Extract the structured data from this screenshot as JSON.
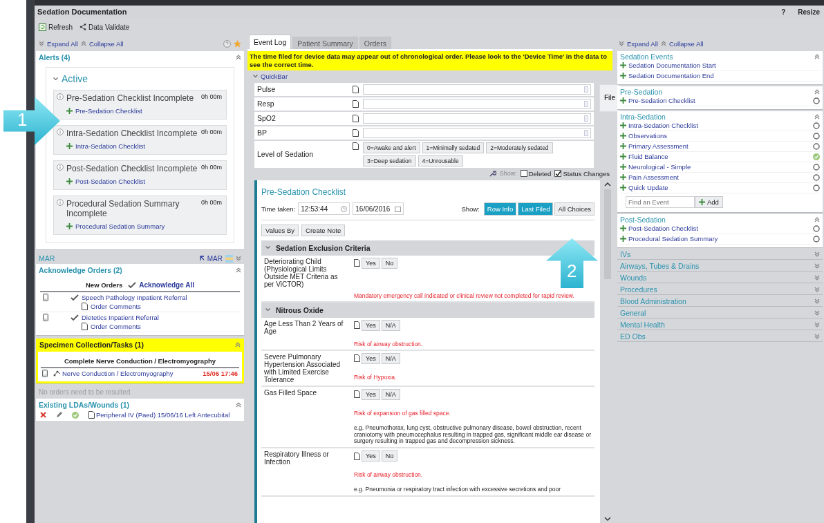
{
  "window": {
    "title": "Sedation Documentation",
    "help": "?",
    "resize": "Resize"
  },
  "toolbar": [
    "Refresh",
    "Data Validate"
  ],
  "callouts": [
    "1",
    "2"
  ],
  "left": {
    "expand_all": "Expand All",
    "collapse_all": "Collapse All",
    "alerts": {
      "title": "Alerts (4)",
      "group": "Active",
      "items": [
        {
          "title": "Pre-Sedation Checklist Incomplete",
          "time": "0h 00m",
          "action": "Pre-Sedation Checklist"
        },
        {
          "title": "Intra-Sedation Checklist Incomplete",
          "time": "0h 00m",
          "action": "Intra-Sedation Checklist"
        },
        {
          "title": "Post-Sedation Checklist Incomplete",
          "time": "0h 00m",
          "action": "Post-Sedation Checklist"
        },
        {
          "title": "Procedural Sedation Summary Incomplete",
          "time": "0h 00m",
          "action": "Procedural Sedation Summary"
        }
      ]
    },
    "mar": {
      "title": "MAR",
      "link": "MAR"
    },
    "acknowledge_orders": {
      "title": "Acknowledge Orders (2)",
      "heading": "New Orders",
      "action": "Acknowledge All",
      "orders": [
        {
          "name": "Speech Pathology Inpatient Referral",
          "comment": "Order Comments"
        },
        {
          "name": "Dietetics Inpatient Referral",
          "comment": "Order Comments"
        }
      ]
    },
    "specimen": {
      "title": "Specimen Collection/Tasks (1)",
      "heading": "Complete Nerve Conduction / Electromyography",
      "task": "Nerve Conduction / Electromyography",
      "time": "15/06 17:46"
    },
    "note": "No orders need to be resulted",
    "ldas": {
      "title": "Existing LDAs/Wounds (1)",
      "item": "Peripheral IV (Paed) 15/06/16 Left Antecubital"
    }
  },
  "center": {
    "tabs": [
      {
        "label": "Event Log",
        "selected": true
      },
      {
        "label": "Patient Summary",
        "selected": false
      },
      {
        "label": "Orders",
        "selected": false
      }
    ],
    "banner": "The time filed for device data may appear out of chronological order. Please look to the 'Device Time' in the data to see the correct time.",
    "quickbar": {
      "title": "QuickBar",
      "fields": [
        {
          "label": "Pulse"
        },
        {
          "label": "Resp"
        },
        {
          "label": "SpO2"
        },
        {
          "label": "BP"
        }
      ],
      "sedation_label": "Level of Sedation",
      "sedation_options": [
        "0=Awake and alert",
        "1=Minimally sedated",
        "2=Moderately sedated",
        "3=Deep sedation",
        "4=Unrousable"
      ],
      "file": "File"
    },
    "show_filters": {
      "label": "Show:",
      "options": [
        {
          "label": "Deleted",
          "checked": false
        },
        {
          "label": "Status Changes",
          "checked": true
        }
      ]
    },
    "form": {
      "title": "Pre-Sedation Checklist",
      "time_label": "Time taken:",
      "time": "12:53:44",
      "date": "16/06/2016",
      "show_label": "Show:",
      "show_buttons": [
        {
          "label": "Row Info",
          "selected": true
        },
        {
          "label": "Last Filed",
          "selected": true
        },
        {
          "label": "All Choices",
          "selected": false
        }
      ],
      "actions": [
        "Values By",
        "Create Note"
      ],
      "sections": [
        {
          "title": "Sedation Exclusion Criteria",
          "rows": [
            {
              "label": "Deteriorating Child (Physiological Limits Outside MET Criteria as per ViCTOR)",
              "options": [
                "Yes",
                "No"
              ],
              "warning": "Mandatory emergency call indicated or clinical review not completed for rapid review."
            }
          ]
        },
        {
          "title": "Nitrous Oxide",
          "rows": [
            {
              "label": "Age Less Than 2 Years of Age",
              "options": [
                "Yes",
                "N/A"
              ],
              "warning": "Risk of airway obstruction."
            },
            {
              "label": "Severe Pulmonary Hypertension Associated with Limited Exercise Tolerance",
              "options": [
                "Yes",
                "N/A"
              ],
              "warning": "Risk of Hypoxia."
            },
            {
              "label": "Gas Filled Space",
              "options": [
                "Yes",
                "N/A"
              ],
              "warning": "Risk of expansion of gas filled space.",
              "note": "e.g. Pneumothorax, lung cyst, obstructive pulmonary disease, bowel obstruction, recent craniotomy with pneumocephalus resulting in trapped gas, significant middle ear disease or surgery resulting in trapped gas and decompression sickness."
            },
            {
              "label": "Respiratory Illness or Infection",
              "options": [
                "Yes",
                "No"
              ],
              "warning": "Risk of airway obstruction.",
              "note": "e.g. Pneumonia or respiratory tract infection with excessive secretions and poor"
            }
          ]
        }
      ]
    }
  },
  "right": {
    "expand_all": "Expand All",
    "collapse_all": "Collapse All",
    "groups": [
      {
        "title": "Sedation Events",
        "expanded": true,
        "items": [
          {
            "label": "Sedation Documentation Start"
          },
          {
            "label": "Sedation Documentation End"
          }
        ]
      },
      {
        "title": "Pre-Sedation",
        "expanded": true,
        "items": [
          {
            "label": "Pre-Sedation Checklist",
            "completed": false
          }
        ]
      },
      {
        "title": "Intra-Sedation",
        "expanded": true,
        "items": [
          {
            "label": "Intra-Sedation Checklist",
            "completed": false
          },
          {
            "label": "Observations",
            "completed": false
          },
          {
            "label": "Primary Assessment",
            "completed": false
          },
          {
            "label": "Fluid Balance",
            "completed": true
          },
          {
            "label": "Neurological - Simple",
            "completed": false
          },
          {
            "label": "Pain Assessment",
            "completed": false
          },
          {
            "label": "Quick Update",
            "completed": false
          }
        ],
        "search": {
          "placeholder": "Find an Event",
          "button": "Add"
        }
      },
      {
        "title": "Post-Sedation",
        "expanded": true,
        "items": [
          {
            "label": "Post-Sedation Checklist",
            "completed": false
          },
          {
            "label": "Procedural Sedation Summary",
            "completed": false
          }
        ]
      },
      {
        "title": "IVs",
        "expanded": false
      },
      {
        "title": "Airways, Tubes & Drains",
        "expanded": false
      },
      {
        "title": "Wounds",
        "expanded": false
      },
      {
        "title": "Procedures",
        "expanded": false
      },
      {
        "title": "Blood Administration",
        "expanded": false
      },
      {
        "title": "General",
        "expanded": false
      },
      {
        "title": "Mental Health",
        "expanded": false
      },
      {
        "title": "ED Obs",
        "expanded": false
      }
    ]
  }
}
